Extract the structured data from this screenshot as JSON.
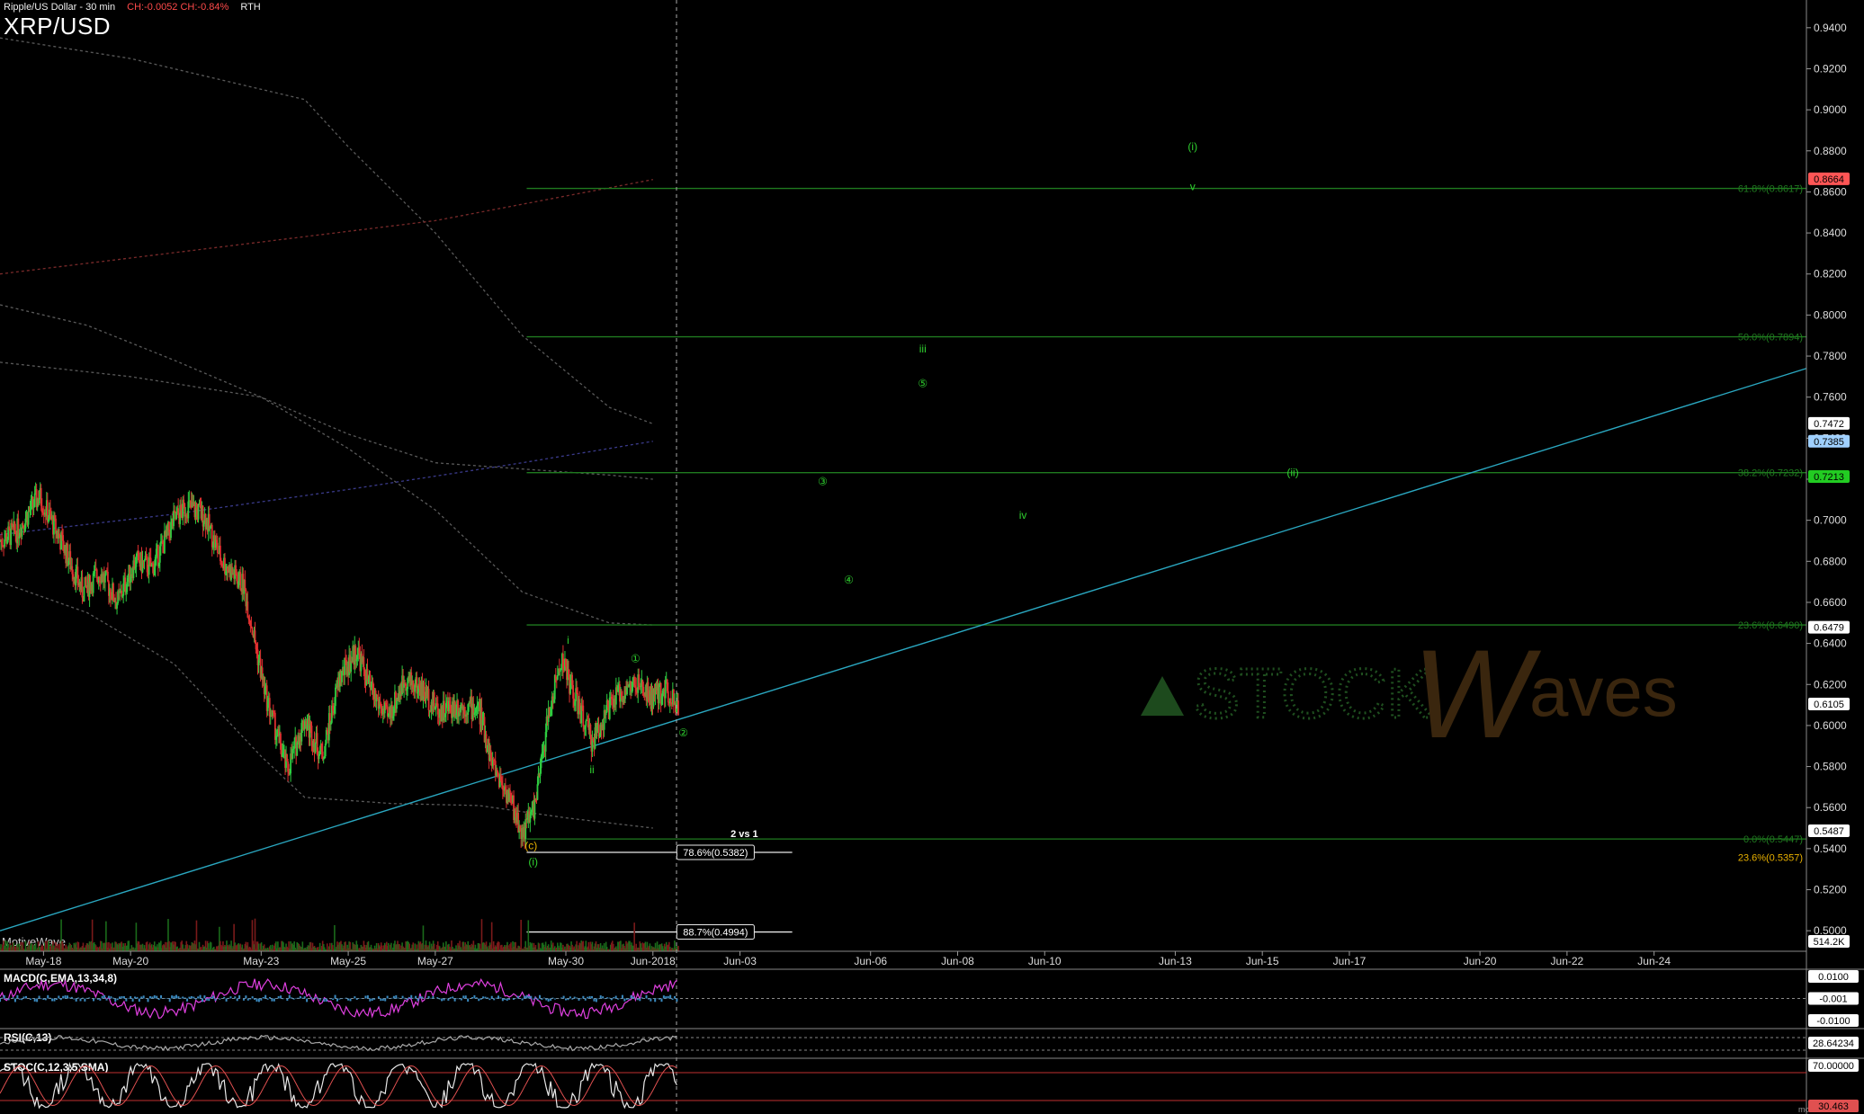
{
  "header": {
    "instrument": "Ripple/US Dollar - 30 min",
    "change": "CH:-0.0052  CH:-0.84%",
    "session": "RTH",
    "symbol": "XRP/USD"
  },
  "brand": "MotiveWave",
  "footer": "motivewave.com",
  "watermark": {
    "prefix": "STOCK",
    "w": "W",
    "suffix": "aves"
  },
  "colors": {
    "background": "#000000",
    "candle_up": "#2ecc40",
    "candle_down": "#e03030",
    "fib": "#1f7a1f",
    "wave_label": "#2fd02f",
    "trendline": "#2aa7c0",
    "price_tag_red": "#ff5555",
    "price_tag_blue": "#9fd0ff",
    "price_tag_green": "#22cc22",
    "orange_label": "#e8b000"
  },
  "chart_data": {
    "type": "candlestick",
    "ylim": [
      0.49,
      0.95
    ],
    "y_ticks": [
      "0.5000",
      "0.5200",
      "0.5400",
      "0.5600",
      "0.5800",
      "0.6000",
      "0.6200",
      "0.6400",
      "0.6600",
      "0.6800",
      "0.7000",
      "0.7200",
      "0.7400",
      "0.7600",
      "0.7800",
      "0.8000",
      "0.8200",
      "0.8400",
      "0.8600",
      "0.8800",
      "0.9000",
      "0.9200",
      "0.9400"
    ],
    "x_ticks": [
      "May-18",
      "May-20",
      "May-23",
      "May-25",
      "May-27",
      "May-30",
      "Jun-2018",
      "Jun-03",
      "Jun-06",
      "Jun-08",
      "Jun-10",
      "Jun-13",
      "Jun-15",
      "Jun-17",
      "Jun-20",
      "Jun-22",
      "Jun-24"
    ],
    "x_tick_days": [
      1,
      3,
      6,
      8,
      10,
      13,
      15,
      17,
      20,
      22,
      24,
      27,
      29,
      31,
      34,
      36,
      38
    ],
    "x_range_days": [
      0,
      41.5
    ],
    "cursor_day": 15,
    "price_path": [
      [
        0,
        0.69
      ],
      [
        0.4,
        0.695
      ],
      [
        0.9,
        0.712
      ],
      [
        1.4,
        0.69
      ],
      [
        1.9,
        0.665
      ],
      [
        2.3,
        0.675
      ],
      [
        2.7,
        0.66
      ],
      [
        3.1,
        0.68
      ],
      [
        3.5,
        0.677
      ],
      [
        4.0,
        0.7
      ],
      [
        4.3,
        0.707
      ],
      [
        4.7,
        0.702
      ],
      [
        5.1,
        0.68
      ],
      [
        5.6,
        0.668
      ],
      [
        6.1,
        0.615
      ],
      [
        6.6,
        0.578
      ],
      [
        7.0,
        0.603
      ],
      [
        7.4,
        0.585
      ],
      [
        7.8,
        0.623
      ],
      [
        8.2,
        0.637
      ],
      [
        8.5,
        0.618
      ],
      [
        8.9,
        0.603
      ],
      [
        9.3,
        0.623
      ],
      [
        9.7,
        0.617
      ],
      [
        10.1,
        0.607
      ],
      [
        10.5,
        0.61
      ],
      [
        11.0,
        0.608
      ],
      [
        11.3,
        0.582
      ],
      [
        11.7,
        0.565
      ],
      [
        12.0,
        0.547
      ],
      [
        12.3,
        0.562
      ],
      [
        12.6,
        0.605
      ],
      [
        12.9,
        0.633
      ],
      [
        13.2,
        0.614
      ],
      [
        13.6,
        0.592
      ],
      [
        13.9,
        0.605
      ],
      [
        14.2,
        0.615
      ],
      [
        14.6,
        0.62
      ],
      [
        15.0,
        0.613
      ],
      [
        15.3,
        0.618
      ],
      [
        15.6,
        0.61
      ]
    ],
    "last_price": 0.6105,
    "volume_label": "514.2K",
    "price_tags": [
      {
        "label": "0.8664",
        "value": 0.8664,
        "color": "#ff5555"
      },
      {
        "label": "0.7472",
        "value": 0.7472,
        "color": "#ffffff"
      },
      {
        "label": "0.7385",
        "value": 0.7385,
        "color": "#9fd0ff"
      },
      {
        "label": "0.7213",
        "value": 0.7213,
        "color": "#22cc22"
      },
      {
        "label": "0.6479",
        "value": 0.6479,
        "color": "#ffffff"
      },
      {
        "label": "0.6105",
        "value": 0.6105,
        "color": "#ffffff"
      },
      {
        "label": "0.5487",
        "value": 0.5487,
        "color": "#ffffff"
      }
    ],
    "fib_levels": [
      {
        "label": "61.8%(0.8617)",
        "value": 0.8617
      },
      {
        "label": "50.0%(0.7894)",
        "value": 0.7894
      },
      {
        "label": "38.2%(0.7232)",
        "value": 0.7232
      },
      {
        "label": "23.6%(0.6490)",
        "value": 0.649
      },
      {
        "label": "0.0%(0.5447)",
        "value": 0.5447
      }
    ],
    "fib_start_day": 12.1,
    "retrace_levels": [
      {
        "label": "78.6%(0.5382)",
        "value": 0.5382
      },
      {
        "label": "88.7%(0.4994)",
        "value": 0.4994
      }
    ],
    "extra_label": {
      "label": "23.6%(0.5357)",
      "value": 0.5357
    },
    "vs_label": "2 vs 1",
    "trendline": [
      [
        0,
        0.5
      ],
      [
        41.5,
        0.774
      ]
    ],
    "wave_labels": [
      {
        "text": "(i)",
        "day": 27.4,
        "value": 0.882
      },
      {
        "text": "v",
        "day": 27.4,
        "value": 0.8625
      },
      {
        "text": "iii",
        "day": 21.2,
        "value": 0.7835
      },
      {
        "text": "⑤",
        "day": 21.2,
        "value": 0.7667
      },
      {
        "text": "③",
        "day": 18.9,
        "value": 0.719
      },
      {
        "text": "④",
        "day": 19.5,
        "value": 0.671
      },
      {
        "text": "iv",
        "day": 23.5,
        "value": 0.7025
      },
      {
        "text": "(ii)",
        "day": 29.7,
        "value": 0.7232
      },
      {
        "text": "i",
        "day": 13.05,
        "value": 0.6415
      },
      {
        "text": "①",
        "day": 14.6,
        "value": 0.6325
      },
      {
        "text": "②",
        "day": 15.7,
        "value": 0.5965
      },
      {
        "text": "ii",
        "day": 13.6,
        "value": 0.5785
      },
      {
        "text": "(c)",
        "day": 12.2,
        "value": 0.5415
      },
      {
        "text": "(i)",
        "day": 12.25,
        "value": 0.5335
      }
    ]
  },
  "indicators": [
    {
      "name": "MACD(C,EMA,13,34,8)",
      "tags": [
        "0.0100",
        "-0.001",
        "-0.0100"
      ]
    },
    {
      "name": "RSI(C,13)",
      "tags": [
        "28.64234"
      ]
    },
    {
      "name": "STOC(C,12,3,5,SMA)",
      "tags": [
        "70.00000",
        "30.463"
      ]
    }
  ]
}
